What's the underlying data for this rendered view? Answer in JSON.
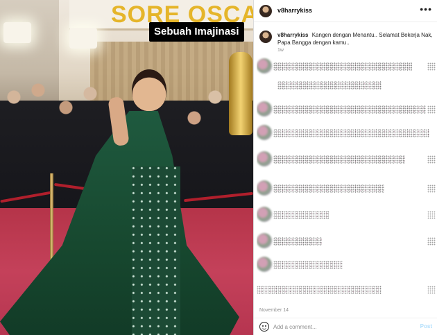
{
  "photo": {
    "sign_text": "SORE OSCAR",
    "overlay_caption": "Sebuah Imajinasi"
  },
  "post": {
    "username": "v8harrykiss",
    "more_icon": "•••",
    "caption_user": "v8harrykiss",
    "caption_text": "Kangen dengan Menantu.. Selamat Bekerja Nak, Papa Bangga dengan kamu..",
    "caption_age": "1w",
    "date": "November 14"
  },
  "comment_box": {
    "placeholder": "Add a comment...",
    "post_label": "Post"
  },
  "colors": {
    "post_disabled": "#b2dffc",
    "caption_bg": "#000000",
    "muted_text": "#8e8e8e"
  }
}
